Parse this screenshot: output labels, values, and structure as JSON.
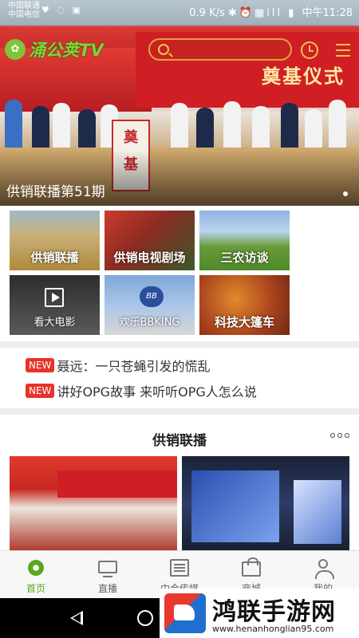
{
  "status_bar": {
    "carrier_line1": "中国联通",
    "carrier_line2": "中国电信",
    "network_speed": "0.9 K/s",
    "time": "中午11:28"
  },
  "app": {
    "logo_text": "涌公荚TV",
    "logo_mark": "✿"
  },
  "hero": {
    "caption": "供销联播第51期",
    "banner_text": "奠基仪式",
    "stone_text_1": "奠",
    "stone_text_2": "基"
  },
  "categories": [
    {
      "label": "供销联播"
    },
    {
      "label": "供销电视剧场"
    },
    {
      "label": "三农访谈"
    },
    {
      "label": "看大电影"
    },
    {
      "label": "欢乐BBKING"
    },
    {
      "label": "科技大篷车"
    }
  ],
  "bbking_mark": "BB",
  "news": [
    {
      "badge": "NEW",
      "text": "聂远：一只苍蝇引发的慌乱"
    },
    {
      "badge": "NEW",
      "text": "讲好OPG故事 来听听OPG人怎么说"
    }
  ],
  "section": {
    "title": "供销联播"
  },
  "bottom_nav": [
    {
      "label": "首页",
      "active": true
    },
    {
      "label": "直播",
      "active": false
    },
    {
      "label": "中合传媒",
      "active": false
    },
    {
      "label": "商城",
      "active": false
    },
    {
      "label": "我的",
      "active": false
    }
  ],
  "watermark": {
    "title": "鸿联手游网",
    "url": "www.henanhonglian95.com"
  },
  "colors": {
    "accent_green": "#5aa71f",
    "badge_red": "#e8332a",
    "icon_gold": "#f4c04b"
  }
}
